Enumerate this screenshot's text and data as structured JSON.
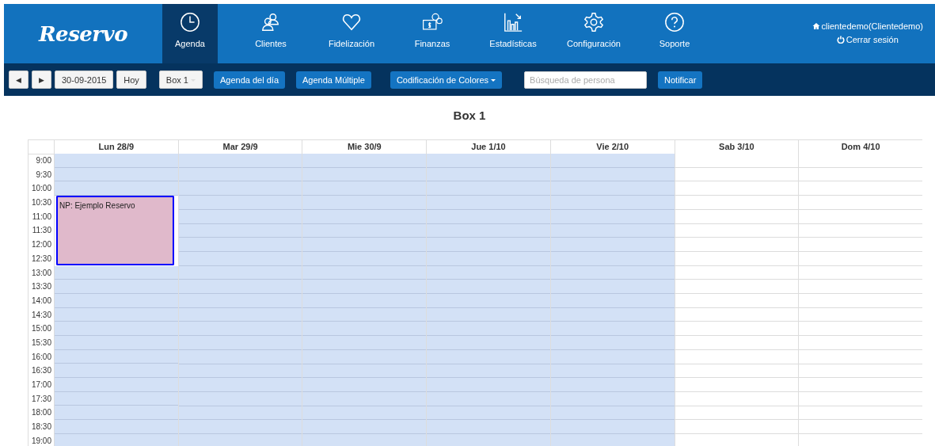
{
  "logo": "Reservo",
  "nav": [
    {
      "label": "Agenda",
      "selected": true
    },
    {
      "label": "Clientes",
      "selected": false
    },
    {
      "label": "Fidelización",
      "selected": false
    },
    {
      "label": "Finanzas",
      "selected": false
    },
    {
      "label": "Estadísticas",
      "selected": false
    },
    {
      "label": "Configuración",
      "selected": false
    },
    {
      "label": "Soporte",
      "selected": false
    }
  ],
  "user": {
    "name": "clientedemo(Clientedemo)",
    "logout": "Cerrar sesión"
  },
  "toolbar": {
    "prev": "◀",
    "next": "▶",
    "date": "30-09-2015",
    "today": "Hoy",
    "box": "Box 1",
    "buttons": [
      "Agenda del día",
      "Agenda Múltiple"
    ],
    "colors": "Codificación de Colores",
    "search": {
      "placeholder": "Búsqueda de persona"
    },
    "notify": "Notificar"
  },
  "calendar": {
    "title": "Box 1",
    "times": [
      "9:00",
      "9:30",
      "10:00",
      "10:30",
      "11:00",
      "11:30",
      "12:00",
      "12:30",
      "13:00",
      "13:30",
      "14:00",
      "14:30",
      "15:00",
      "15:30",
      "16:00",
      "16:30",
      "17:00",
      "17:30",
      "18:00",
      "18:30",
      "19:00"
    ],
    "days": [
      {
        "label": "Lun 28/9",
        "available": true,
        "booked": [
          false,
          false,
          false,
          true,
          true,
          true,
          true,
          true,
          false,
          false,
          false,
          false,
          false,
          false,
          false,
          false,
          false,
          false,
          false,
          false,
          false
        ],
        "events": [
          {
            "label": "NP: Ejemplo Reservo"
          }
        ]
      },
      {
        "label": "Mar 29/9",
        "available": true
      },
      {
        "label": "Mie 30/9",
        "available": true
      },
      {
        "label": "Jue 1/10",
        "available": true
      },
      {
        "label": "Vie 2/10",
        "available": true
      },
      {
        "label": "Sab 3/10",
        "available": false
      },
      {
        "label": "Dom 4/10",
        "available": false
      }
    ]
  }
}
